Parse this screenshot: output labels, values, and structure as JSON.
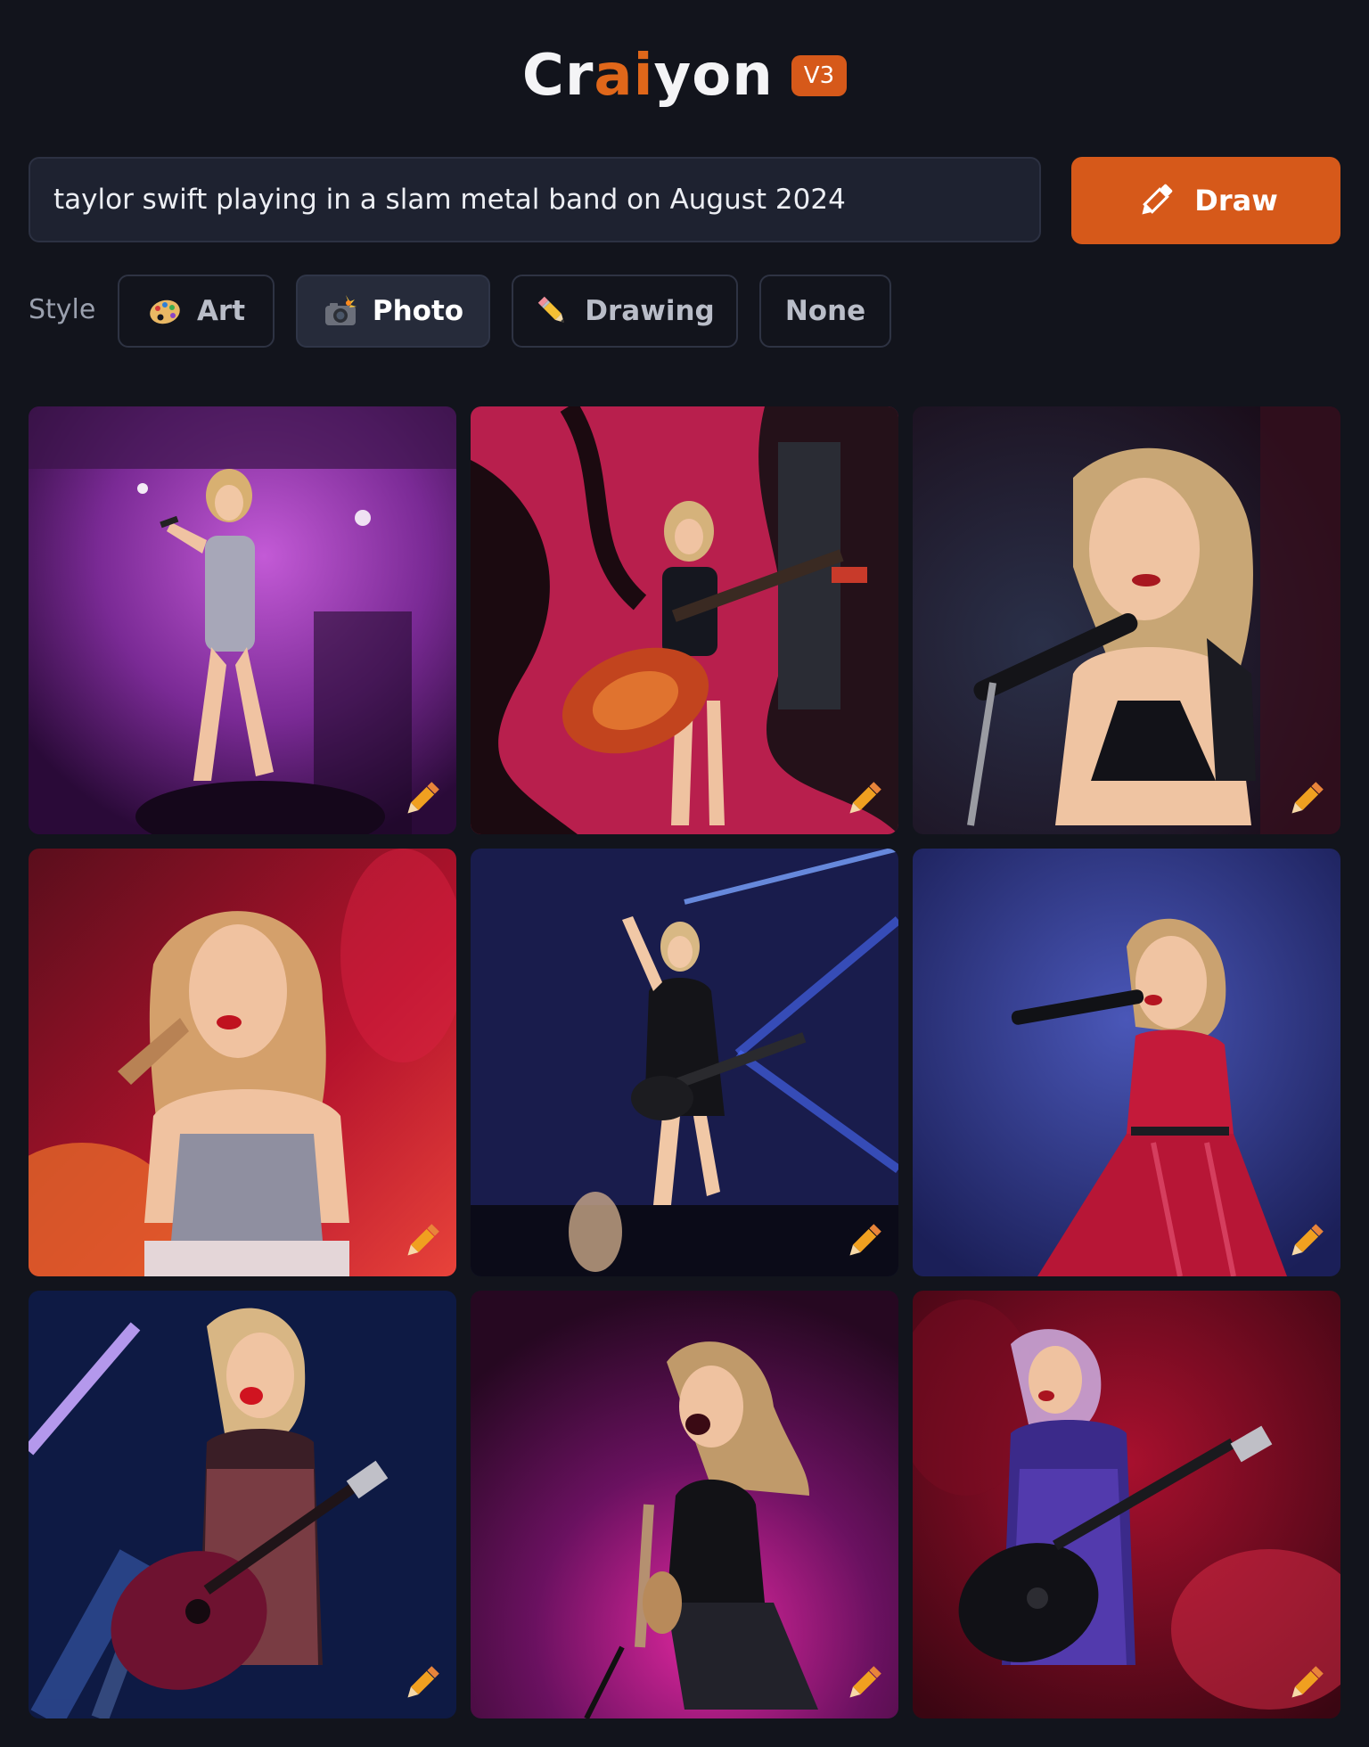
{
  "header": {
    "logo_part1": "Cr",
    "logo_accent": "ai",
    "logo_part2": "yon",
    "version": "V3"
  },
  "prompt": {
    "value": "taylor swift playing in a slam metal band on August 2024",
    "draw_label": "Draw"
  },
  "style": {
    "label": "Style",
    "options": [
      {
        "label": "Art",
        "icon": "palette-icon",
        "active": false
      },
      {
        "label": "Photo",
        "icon": "camera-flash-icon",
        "active": true
      },
      {
        "label": "Drawing",
        "icon": "pencil-icon",
        "active": false
      },
      {
        "label": "None",
        "icon": "",
        "active": false
      }
    ]
  },
  "colors": {
    "background": "#12141c",
    "accent": "#d6591a",
    "input_bg": "#1e2230"
  },
  "results": [
    {
      "scene": "singer with microphone on purple-lit stage",
      "edit_icon": "pencil-edit-icon"
    },
    {
      "scene": "singer playing red electric guitar, red and black backdrop",
      "edit_icon": "pencil-edit-icon"
    },
    {
      "scene": "close-up singer with microphone, dark background",
      "edit_icon": "pencil-edit-icon"
    },
    {
      "scene": "singer in sequined top, red fiery background",
      "edit_icon": "pencil-edit-icon"
    },
    {
      "scene": "singer with bass guitar, blue stage lights",
      "edit_icon": "pencil-edit-icon"
    },
    {
      "scene": "singer in red dress with microphone, blue background",
      "edit_icon": "pencil-edit-icon"
    },
    {
      "scene": "singer with acoustic guitar, blue light beams",
      "edit_icon": "pencil-edit-icon"
    },
    {
      "scene": "singer screaming with guitar, magenta background",
      "edit_icon": "pencil-edit-icon"
    },
    {
      "scene": "singer with black guitar, red smoke",
      "edit_icon": "pencil-edit-icon"
    }
  ]
}
